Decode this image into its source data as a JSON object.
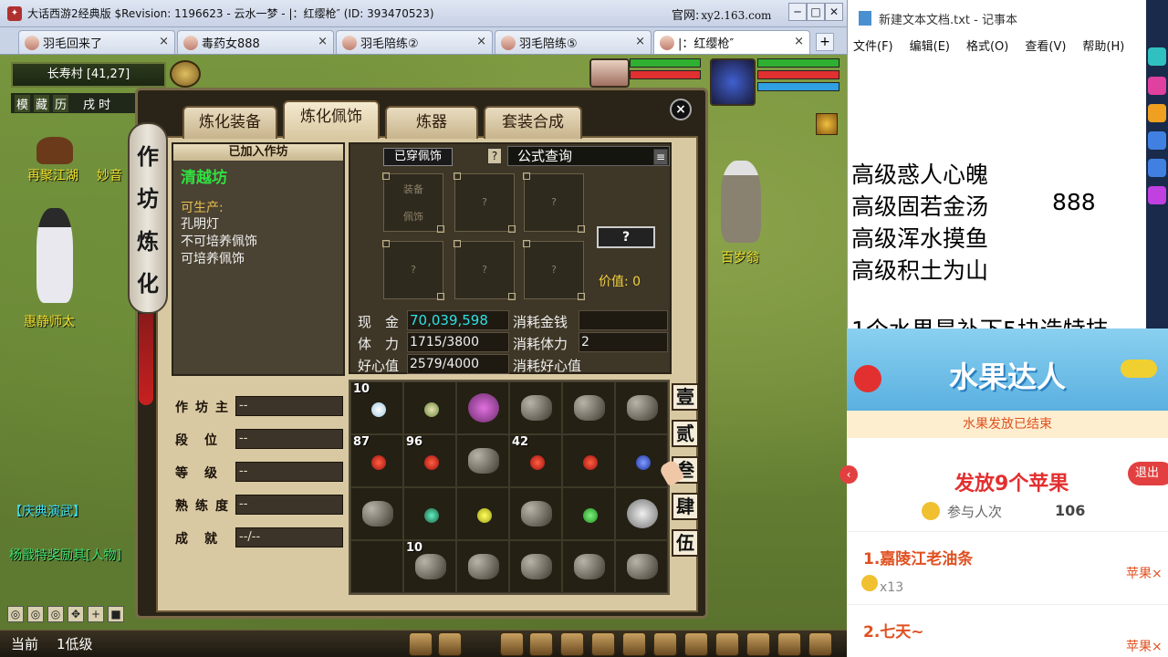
{
  "browser": {
    "title": "大话西游2经典版 $Revision: 1196623 - 云水一梦 - |：红缨枪″ (ID: 393470523)",
    "site_label": "官网:",
    "site_url": "xy2.163.com",
    "tabs": [
      {
        "label": "羽毛回来了"
      },
      {
        "label": "毒药女888"
      },
      {
        "label": "羽毛陪练②"
      },
      {
        "label": "羽毛陪练⑤"
      },
      {
        "label": "|：红缨枪″"
      }
    ],
    "tab_close": "×",
    "tab_add": "+",
    "min": "─",
    "max": "□",
    "close": "✕"
  },
  "hud": {
    "location": "长寿村",
    "coords": "[41,27]",
    "icon_labels": [
      "模",
      "藏",
      "历"
    ],
    "time_text": "戌 时",
    "npcs": [
      "再聚江湖",
      "妙音",
      "惠静师太",
      "百岁翁"
    ],
    "chat": [
      {
        "tag": "【庆典演武】",
        "color": "#40e0f0"
      },
      {
        "tag": "杨戬特奖励其[人物]",
        "color": "#40e070"
      }
    ],
    "bottom_label": "当前",
    "bottom_level": "1低级",
    "ctrl_buttons": [
      "◎",
      "◎",
      "◎",
      "✥",
      "+",
      "■"
    ],
    "colors": {
      "hp": "#e03030",
      "mp": "#30b030",
      "sp": "#30a0e0"
    }
  },
  "panel": {
    "tabs": [
      "炼化装备",
      "炼化佩饰",
      "炼器",
      "套装合成"
    ],
    "active_tab": 1,
    "side_caption": [
      "作",
      "坊",
      "炼",
      "化"
    ],
    "close": "×",
    "workshop": {
      "header": "已加入作坊",
      "name": "清越坊",
      "can_produce_label": "可生产:",
      "items": [
        "孔明灯",
        "不可培养佩饰",
        "可培养佩饰"
      ]
    },
    "info": [
      {
        "label": "作坊主",
        "value": "--"
      },
      {
        "label": "段位",
        "value": "--"
      },
      {
        "label": "等级",
        "value": "--"
      },
      {
        "label": "熟练度",
        "value": "--"
      },
      {
        "label": "成就",
        "value": "--/--"
      }
    ],
    "equip": {
      "worn_button": "已穿佩饰",
      "help": "?",
      "formula": "公式查询",
      "slot_hint": [
        "装备",
        "佩饰"
      ],
      "slot_q": "?",
      "big_q": "?",
      "worth_label": "价值:",
      "worth_value": "0"
    },
    "stats": [
      {
        "label": "现　金",
        "value": "70,039,598",
        "cons_label": "消耗金钱",
        "cons_value": ""
      },
      {
        "label": "体　力",
        "value": "1715/3800",
        "cons_label": "消耗体力",
        "cons_value": "2"
      },
      {
        "label": "好心值",
        "value": "2579/4000",
        "cons_label": "消耗好心值",
        "cons_value": ""
      }
    ],
    "page_buttons": [
      "壹",
      "贰",
      "叁",
      "肆",
      "伍"
    ],
    "inventory_counts": {
      "0": "10",
      "6": "87",
      "7": "96",
      "9": "42",
      "19": "10"
    }
  },
  "notepad": {
    "title": "新建文本文档.txt - 记事本",
    "menus": [
      "文件(F)",
      "编辑(E)",
      "格式(O)",
      "查看(V)",
      "帮助(H)"
    ],
    "lines": [
      "高级惑人心魄",
      "高级固若金汤",
      "高级浑水摸鱼",
      "高级积土为山"
    ],
    "number": "888",
    "partial_line": "1个水果是补下5块造特技"
  },
  "fruit": {
    "title": "水果达人",
    "status": "水果发放已结束",
    "give": "发放9个苹果",
    "join_label": "参与人次",
    "join_count": "106",
    "exit": "退出",
    "ranks": [
      {
        "name": "1.嘉陵江老油条",
        "mult": "x13",
        "prize": "苹果×"
      },
      {
        "name": "2.七天~",
        "mult": "",
        "prize": "苹果×"
      }
    ]
  }
}
